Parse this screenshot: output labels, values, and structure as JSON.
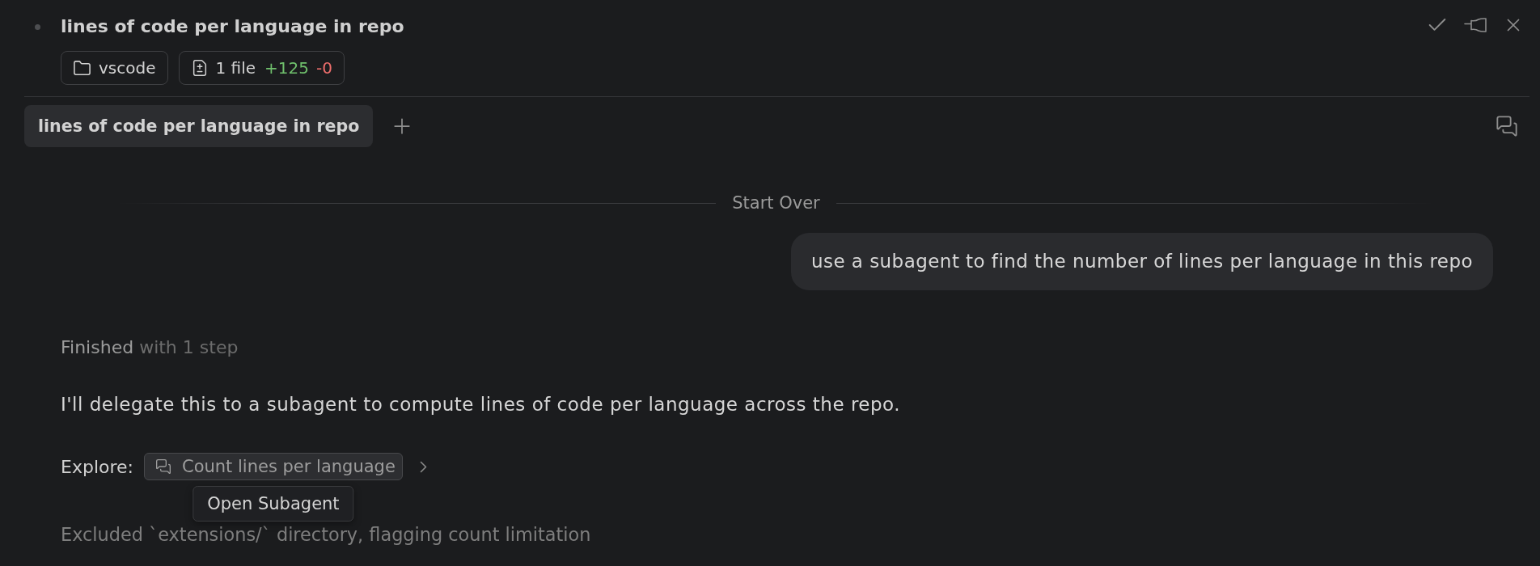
{
  "header": {
    "title": "lines of code per language in repo",
    "workspace": {
      "label": "vscode"
    },
    "changes": {
      "files": "1 file",
      "added": "+125",
      "removed": "-0"
    }
  },
  "tabs": [
    {
      "label": "lines of code per language in repo",
      "selected": true
    }
  ],
  "conversation": {
    "divider_label": "Start Over",
    "user_message": "use a subagent to find the number of lines per language in this repo",
    "status": {
      "label": "Finished",
      "detail": "with 1 step"
    },
    "reply": "I'll delegate this to a subagent to compute lines of code per language across the repo.",
    "explore": {
      "label": "Explore:",
      "task": "Count lines per language",
      "tooltip": "Open Subagent"
    },
    "note": "Excluded `extensions/` directory, flagging count limitation"
  }
}
